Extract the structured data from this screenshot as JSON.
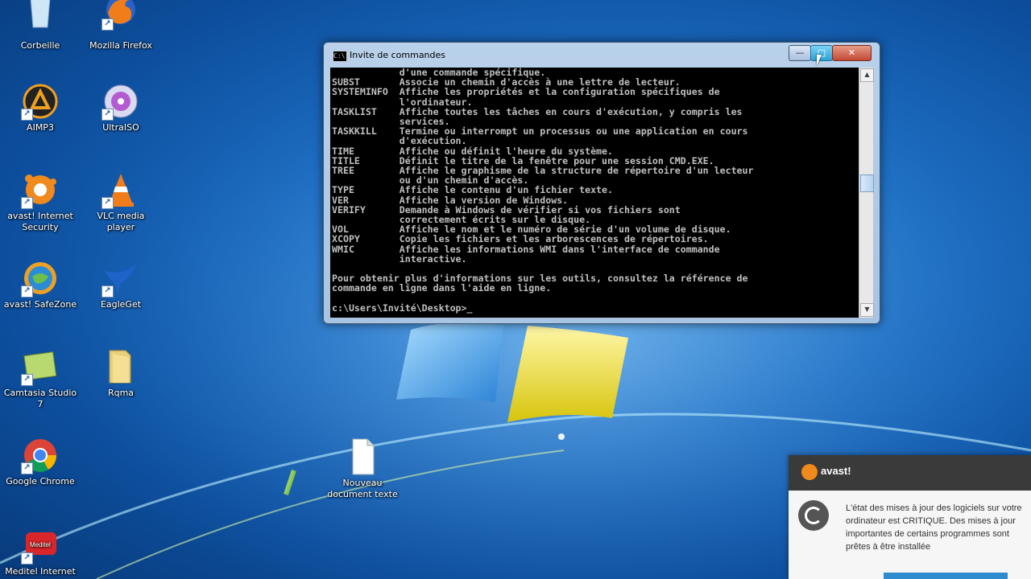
{
  "desktop": {
    "icons": [
      {
        "label": "Corbeille",
        "icon": "recycle-bin-icon"
      },
      {
        "label": "Mozilla Firefox",
        "icon": "firefox-icon"
      },
      {
        "label": "AIMP3",
        "icon": "aimp-icon"
      },
      {
        "label": "UltraISO",
        "icon": "disc-icon"
      },
      {
        "label": "avast! Internet Security",
        "icon": "avast-icon"
      },
      {
        "label": "VLC media player",
        "icon": "vlc-cone-icon"
      },
      {
        "label": "avast! SafeZone",
        "icon": "globe-icon"
      },
      {
        "label": "EagleGet",
        "icon": "eagle-icon"
      },
      {
        "label": "Camtasia Studio 7",
        "icon": "camtasia-icon"
      },
      {
        "label": "Rqma",
        "icon": "folder-icon"
      },
      {
        "label": "Google Chrome",
        "icon": "chrome-icon"
      },
      {
        "label": "Nouveau document texte",
        "icon": "text-document-icon"
      },
      {
        "label": "Meditel Internet",
        "icon": "meditel-icon"
      }
    ]
  },
  "cmd_window": {
    "title": "Invite de commandes",
    "buttons": {
      "minimize": "—",
      "maximize": "□",
      "close": "✕"
    },
    "console_lines": [
      "            d'une commande spécifique.",
      "SUBST       Associe un chemin d'accès à une lettre de lecteur.",
      "SYSTEMINFO  Affiche les propriétés et la configuration spécifiques de",
      "            l'ordinateur.",
      "TASKLIST    Affiche toutes les tâches en cours d'exécution, y compris les",
      "            services.",
      "TASKKILL    Termine ou interrompt un processus ou une application en cours",
      "            d'exécution.",
      "TIME        Affiche ou définit l'heure du système.",
      "TITLE       Définit le titre de la fenêtre pour une session CMD.EXE.",
      "TREE        Affiche le graphisme de la structure de répertoire d'un lecteur",
      "            ou d'un chemin d'accès.",
      "TYPE        Affiche le contenu d'un fichier texte.",
      "VER         Affiche la version de Windows.",
      "VERIFY      Demande à Windows de vérifier si vos fichiers sont",
      "            correctement écrits sur le disque.",
      "VOL         Affiche le nom et le numéro de série d'un volume de disque.",
      "XCOPY       Copie les fichiers et les arborescences de répertoires.",
      "WMIC        Affiche les informations WMI dans l'interface de commande",
      "            interactive.",
      "",
      "Pour obtenir plus d'informations sur les outils, consultez la référence de",
      "commande en ligne dans l'aide en ligne.",
      "",
      "c:\\Users\\Invité\\Desktop>_"
    ]
  },
  "avast_popup": {
    "brand": "avast!",
    "message": "L'état des mises à jour des logiciels sur votre ordinateur est CRITIQUE. Des mises à jour importantes de certains programmes sont prêtes à être installée"
  }
}
